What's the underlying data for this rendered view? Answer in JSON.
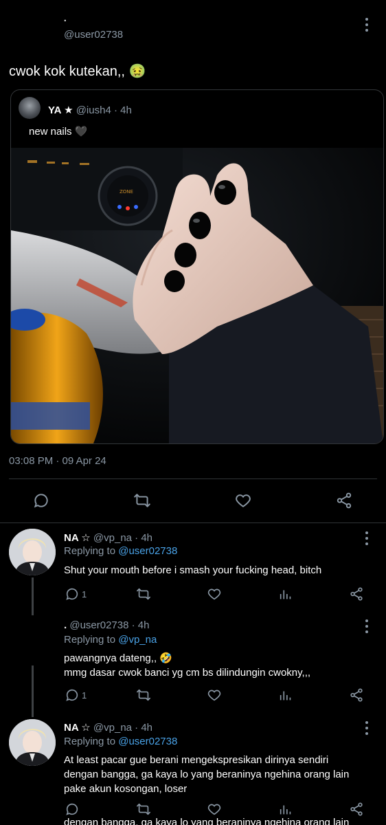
{
  "header": {
    "dot": ".",
    "handle": "@user02738"
  },
  "tweet": {
    "text": "cwok kok kutekan,, 🤢",
    "timestamp": "03:08 PM · 09 Apr 24"
  },
  "quote": {
    "name": "YA ★",
    "handle_time": "@iush4 · 4h",
    "text": "new nails 🖤",
    "photo_icon": "car-interior-hand-black-nails-photo"
  },
  "replies": [
    {
      "name": "NA ☆",
      "handle_time": "@vp_na · 4h",
      "replying_prefix": "Replying to ",
      "replying_to": "@user02738",
      "text": "Shut your mouth before i smash your fucking head, bitch",
      "reply_count": "1"
    },
    {
      "name": ".",
      "handle_time": "@user02738 · 4h",
      "replying_prefix": "Replying to ",
      "replying_to": "@vp_na",
      "text_line1": "pawangnya dateng,, 🤣",
      "text_line2": "mmg dasar cwok banci yg cm bs dilindungin cwokny,,,",
      "reply_count": "1"
    },
    {
      "name": "NA ☆",
      "handle_time": "@vp_na · 4h",
      "replying_prefix": "Replying to ",
      "replying_to": "@user02738",
      "text_line1": "At least pacar gue berani mengekspresikan dirinya sendiri",
      "text_line2": "dengan bangga, ga kaya lo yang beraninya ngehina orang lain",
      "text_line3": "pake akun kosongan, loser",
      "reply_count": ""
    }
  ],
  "cut_text": "dengan bangga, ga kaya lo yang beraninya ngehina orang lain",
  "colors": {
    "background": "#000000",
    "text": "#e7e9ea",
    "secondary": "#8b98a5",
    "link": "#4aa3e8",
    "divider": "#2f3336"
  }
}
